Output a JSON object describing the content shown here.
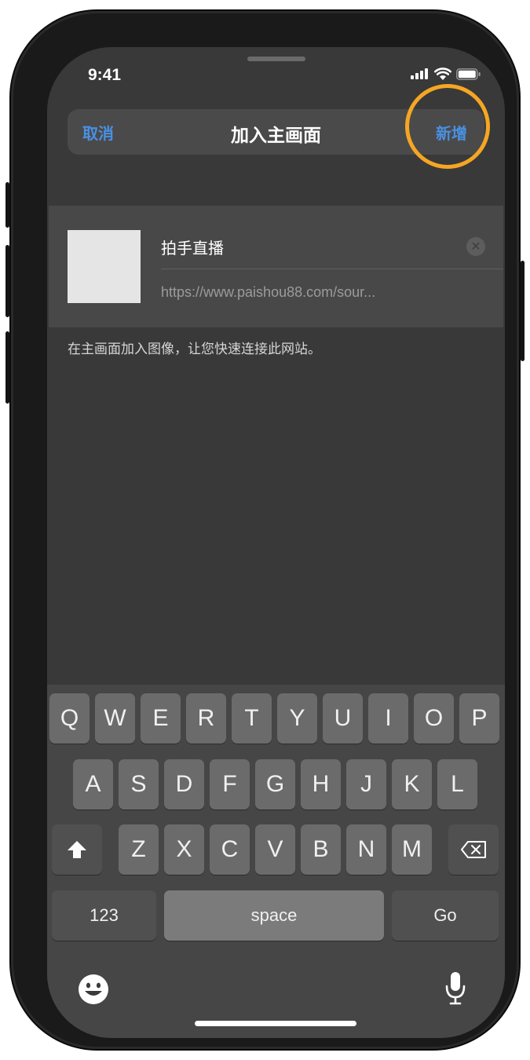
{
  "status_bar": {
    "time": "9:41"
  },
  "nav": {
    "cancel": "取消",
    "title": "加入主画面",
    "add": "新增"
  },
  "bookmark": {
    "name": "拍手直播",
    "url": "https://www.paishou88.com/sour..."
  },
  "hint": "在主画面加入图像，让您快速连接此网站。",
  "keyboard": {
    "row1": [
      "Q",
      "W",
      "E",
      "R",
      "T",
      "Y",
      "U",
      "I",
      "O",
      "P"
    ],
    "row2": [
      "A",
      "S",
      "D",
      "F",
      "G",
      "H",
      "J",
      "K",
      "L"
    ],
    "row3": [
      "Z",
      "X",
      "C",
      "V",
      "B",
      "N",
      "M"
    ],
    "numbers": "123",
    "space": "space",
    "go": "Go"
  },
  "colors": {
    "link": "#4a90e2",
    "highlight": "#f5a623",
    "background": "#393939"
  }
}
